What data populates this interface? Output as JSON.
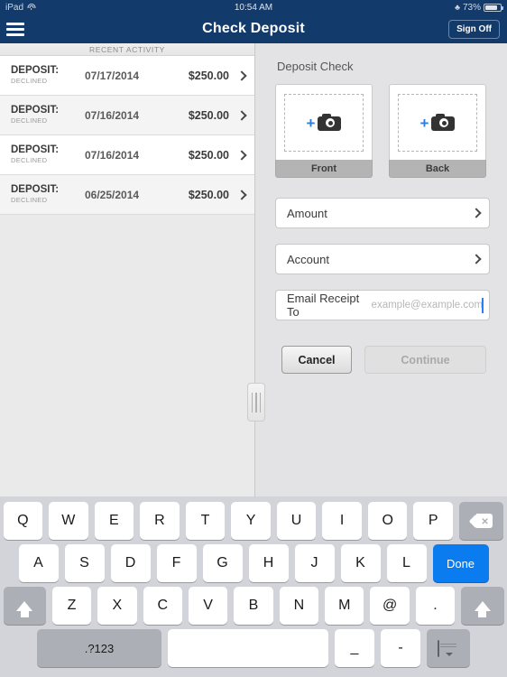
{
  "status_bar": {
    "device": "iPad",
    "wifi_icon": "wifi-icon",
    "time": "10:54 AM",
    "bluetooth_icon": "bluetooth-icon",
    "battery_percent": "73%",
    "battery_icon": "battery-icon"
  },
  "nav": {
    "menu_icon": "hamburger-menu-icon",
    "title": "Check Deposit",
    "sign_off_label": "Sign Off"
  },
  "sidebar": {
    "header": "RECENT ACTIVITY",
    "rows": [
      {
        "type": "DEPOSIT:",
        "status": "DECLINED",
        "date": "07/17/2014",
        "amount": "$250.00",
        "chevron_icon": "chevron-right-icon"
      },
      {
        "type": "DEPOSIT:",
        "status": "DECLINED",
        "date": "07/16/2014",
        "amount": "$250.00",
        "chevron_icon": "chevron-right-icon"
      },
      {
        "type": "DEPOSIT:",
        "status": "DECLINED",
        "date": "07/16/2014",
        "amount": "$250.00",
        "chevron_icon": "chevron-right-icon"
      },
      {
        "type": "DEPOSIT:",
        "status": "DECLINED",
        "date": "06/25/2014",
        "amount": "$250.00",
        "chevron_icon": "chevron-right-icon"
      }
    ]
  },
  "main": {
    "title": "Deposit Check",
    "capture": [
      {
        "label": "Front",
        "icon": "add-photo-camera-icon"
      },
      {
        "label": "Back",
        "icon": "add-photo-camera-icon"
      }
    ],
    "fields": {
      "amount_label": "Amount",
      "account_label": "Account",
      "email_label": "Email Receipt To",
      "email_placeholder": "example@example.com",
      "email_value": ""
    },
    "buttons": {
      "cancel": "Cancel",
      "continue": "Continue"
    },
    "divider_handle_icon": "split-view-grip-icon"
  },
  "keyboard": {
    "row1": [
      "Q",
      "W",
      "E",
      "R",
      "T",
      "Y",
      "U",
      "I",
      "O",
      "P"
    ],
    "row2": [
      "A",
      "S",
      "D",
      "F",
      "G",
      "H",
      "J",
      "K",
      "L"
    ],
    "row3": [
      "Z",
      "X",
      "C",
      "V",
      "B",
      "N",
      "M",
      "@",
      "."
    ],
    "backspace_icon": "backspace-icon",
    "done_label": "Done",
    "shift_icon": "shift-arrow-icon",
    "numbers_label": ".?123",
    "space_label": "",
    "underscore_label": "_",
    "hyphen_label": "-",
    "hide_keyboard_icon": "hide-keyboard-icon"
  },
  "colors": {
    "nav_blue": "#123a6b",
    "accent_blue": "#2f7fd8",
    "done_blue": "#0b7cf0",
    "panel_gray": "#e3e3e5"
  }
}
